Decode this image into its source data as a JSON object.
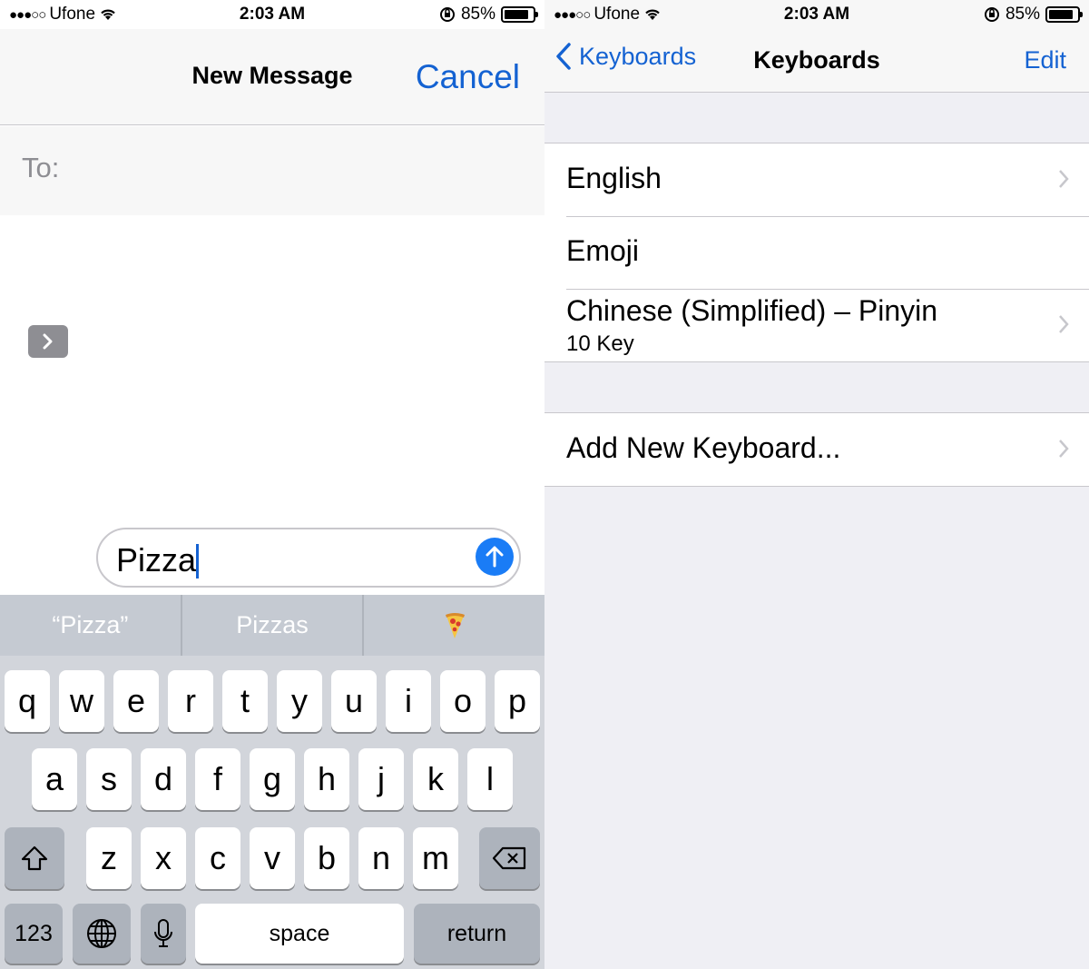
{
  "left": {
    "status": {
      "carrier": "Ufone",
      "time": "2:03 AM",
      "battery": "85%"
    },
    "nav": {
      "title": "New Message",
      "cancel": "Cancel"
    },
    "to_label": "To:",
    "input": {
      "text": "Pizza"
    },
    "predictions": [
      "“Pizza”",
      "Pizzas",
      "🍕"
    ],
    "keyboard": {
      "row1": [
        "q",
        "w",
        "e",
        "r",
        "t",
        "y",
        "u",
        "i",
        "o",
        "p"
      ],
      "row2": [
        "a",
        "s",
        "d",
        "f",
        "g",
        "h",
        "j",
        "k",
        "l"
      ],
      "row3": [
        "z",
        "x",
        "c",
        "v",
        "b",
        "n",
        "m"
      ],
      "numbers": "123",
      "space": "space",
      "return": "return"
    }
  },
  "right": {
    "status": {
      "carrier": "Ufone",
      "time": "2:03 AM",
      "battery": "85%"
    },
    "nav": {
      "back": "Keyboards",
      "title": "Keyboards",
      "edit": "Edit"
    },
    "keyboards": [
      {
        "name": "English",
        "sub": "",
        "chevron": true
      },
      {
        "name": "Emoji",
        "sub": "",
        "chevron": false
      },
      {
        "name": "Chinese (Simplified) – Pinyin",
        "sub": "10 Key",
        "chevron": true
      }
    ],
    "add": "Add New Keyboard..."
  },
  "accent_color": "#1462d2",
  "battery_level": 0.85
}
